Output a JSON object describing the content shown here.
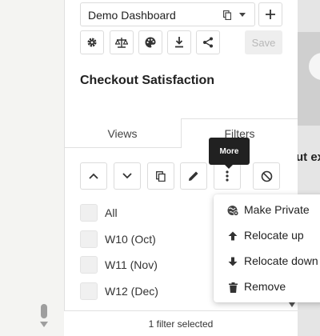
{
  "dashboard": {
    "selected": "Demo Dashboard",
    "save_label": "Save",
    "title": "Checkout Satisfaction"
  },
  "tabs": [
    {
      "label": "Views"
    },
    {
      "label": "Filters"
    }
  ],
  "tooltip": {
    "label": "More"
  },
  "background": {
    "partial_text": "ut ex"
  },
  "filters": [
    {
      "label": "All"
    },
    {
      "label": "W10 (Oct)"
    },
    {
      "label": "W11 (Nov)"
    },
    {
      "label": "W12 (Dec)"
    }
  ],
  "status": {
    "text": "1 filter selected"
  },
  "menu": {
    "items": [
      {
        "label": "Make Private",
        "icon": "make-private-icon"
      },
      {
        "label": "Relocate up",
        "icon": "arrow-up-icon"
      },
      {
        "label": "Relocate down",
        "icon": "arrow-down-icon"
      },
      {
        "label": "Remove",
        "icon": "trash-icon"
      }
    ]
  },
  "colors": {
    "accent": "#212121",
    "save_disabled": "#b8b8b8"
  }
}
